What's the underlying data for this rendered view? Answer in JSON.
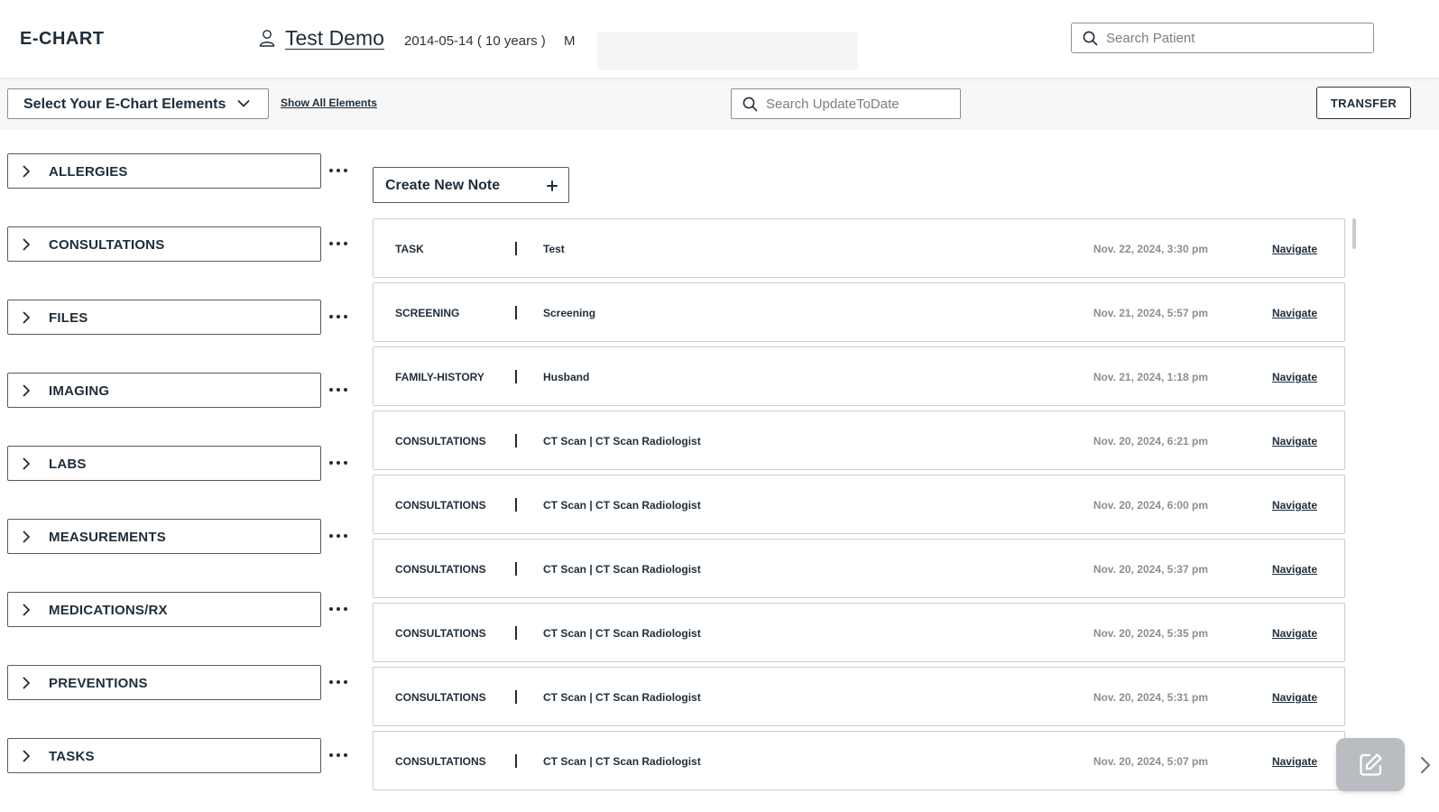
{
  "header": {
    "app_title": "E-CHART",
    "patient_name": "Test Demo",
    "patient_dob": "2014-05-14 ( 10 years )",
    "patient_sex": "M",
    "search_placeholder": "Search Patient"
  },
  "toolbar": {
    "select_label": "Select Your E-Chart Elements",
    "show_all_label": "Show All Elements",
    "search_placeholder": "Search UpdateToDate",
    "transfer_label": "TRANSFER"
  },
  "sidebar": {
    "items": [
      {
        "label": "ALLERGIES"
      },
      {
        "label": "CONSULTATIONS"
      },
      {
        "label": "FILES"
      },
      {
        "label": "IMAGING"
      },
      {
        "label": "LABS"
      },
      {
        "label": "MEASUREMENTS"
      },
      {
        "label": "MEDICATIONS/RX"
      },
      {
        "label": "PREVENTIONS"
      },
      {
        "label": "TASKS"
      }
    ]
  },
  "notes": {
    "create_label": "Create New Note",
    "navigate_label": "Navigate",
    "rows": [
      {
        "type": "TASK",
        "description": "Test",
        "date": "Nov. 22, 2024, 3:30 pm"
      },
      {
        "type": "SCREENING",
        "description": "Screening",
        "date": "Nov. 21, 2024, 5:57 pm"
      },
      {
        "type": "FAMILY-HISTORY",
        "description": "Husband",
        "date": "Nov. 21, 2024, 1:18 pm"
      },
      {
        "type": "CONSULTATIONS",
        "description": "CT Scan | CT Scan Radiologist",
        "date": "Nov. 20, 2024, 6:21 pm"
      },
      {
        "type": "CONSULTATIONS",
        "description": "CT Scan | CT Scan Radiologist",
        "date": "Nov. 20, 2024, 6:00 pm"
      },
      {
        "type": "CONSULTATIONS",
        "description": "CT Scan | CT Scan Radiologist",
        "date": "Nov. 20, 2024, 5:37 pm"
      },
      {
        "type": "CONSULTATIONS",
        "description": "CT Scan | CT Scan Radiologist",
        "date": "Nov. 20, 2024, 5:35 pm"
      },
      {
        "type": "CONSULTATIONS",
        "description": "CT Scan | CT Scan Radiologist",
        "date": "Nov. 20, 2024, 5:31 pm"
      },
      {
        "type": "CONSULTATIONS",
        "description": "CT Scan | CT Scan Radiologist",
        "date": "Nov. 20, 2024, 5:07 pm"
      }
    ]
  },
  "icons": {
    "user": "user-icon",
    "search": "search-icon",
    "chevron_down": "chevron-down-icon",
    "chevron_right": "chevron-right-icon",
    "more": "more-horizontal-icon",
    "plus": "plus-icon",
    "edit": "edit-note-icon"
  },
  "colors": {
    "text": "#1f2d3a",
    "muted_date": "#8a8f94",
    "toolbar_bg": "#f7f7f7",
    "fab_bg": "#b9bdc1"
  }
}
